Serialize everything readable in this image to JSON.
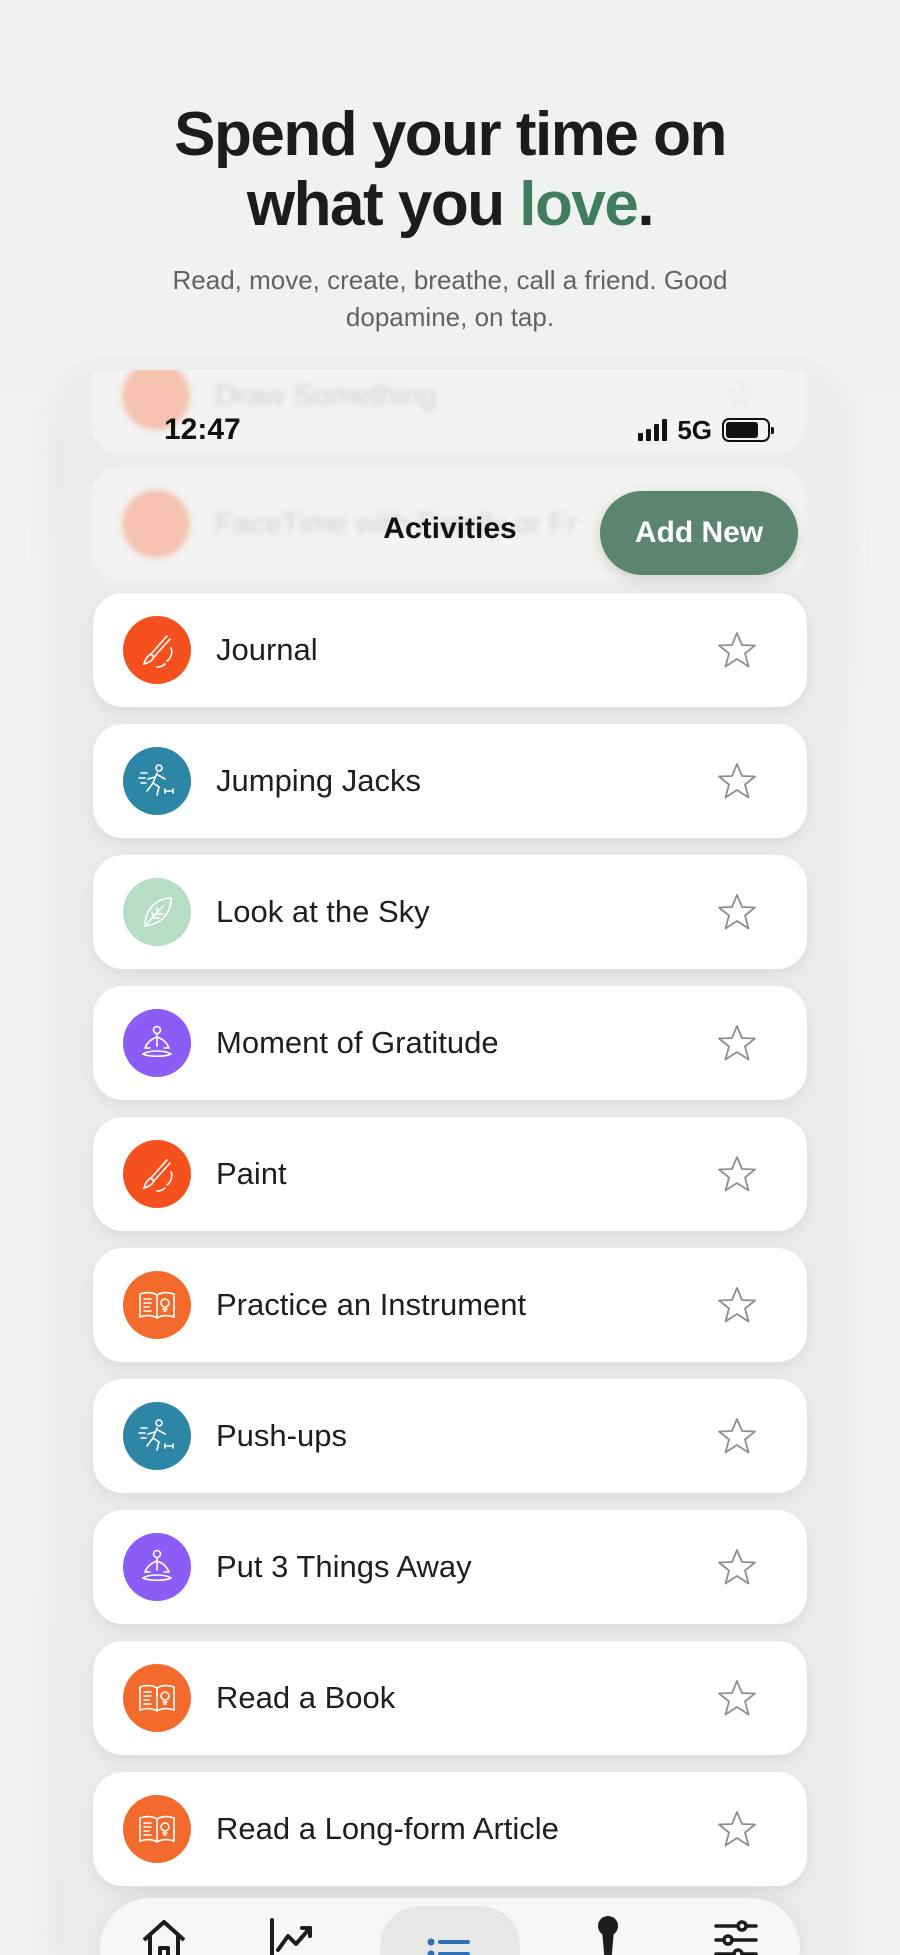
{
  "hero": {
    "headline_line1": "Spend your time on",
    "headline_line2_prefix": "what you ",
    "headline_accent": "love",
    "headline_suffix": ".",
    "subtitle": "Read, move, create, breathe, call a friend. Good dopamine, on tap.",
    "accent_color": "#3f7d5d"
  },
  "ghost_rows": [
    {
      "label": "Draw Something"
    },
    {
      "label": "FaceTime with Family or Fr"
    }
  ],
  "status_bar": {
    "time": "12:47",
    "network": "5G"
  },
  "nav": {
    "title": "Activities",
    "add_button_label": "Add New",
    "add_button_color": "#5b8570"
  },
  "activities": [
    {
      "label": "Journal",
      "icon": "paintbrush-icon",
      "color": "#f4511e"
    },
    {
      "label": "Jumping Jacks",
      "icon": "running-icon",
      "color": "#2e86a6"
    },
    {
      "label": "Look at the Sky",
      "icon": "leaf-icon",
      "color": "#b7dec5"
    },
    {
      "label": "Moment of Gratitude",
      "icon": "meditation-icon",
      "color": "#8b5cf6"
    },
    {
      "label": "Paint",
      "icon": "paintbrush-icon",
      "color": "#f4511e"
    },
    {
      "label": "Practice an Instrument",
      "icon": "book-icon",
      "color": "#f36b2c"
    },
    {
      "label": "Push-ups",
      "icon": "running-icon",
      "color": "#2e86a6"
    },
    {
      "label": "Put 3 Things Away",
      "icon": "meditation-icon",
      "color": "#8b5cf6"
    },
    {
      "label": "Read a Book",
      "icon": "book-icon",
      "color": "#f36b2c"
    },
    {
      "label": "Read a Long-form Article",
      "icon": "book-icon",
      "color": "#f36b2c"
    }
  ],
  "tab_bar": [
    {
      "icon": "home-icon",
      "active": false
    },
    {
      "icon": "trend-chart-icon",
      "active": false
    },
    {
      "icon": "list-icon",
      "active": true
    },
    {
      "icon": "keyhole-icon",
      "active": false
    },
    {
      "icon": "sliders-icon",
      "active": false
    }
  ]
}
